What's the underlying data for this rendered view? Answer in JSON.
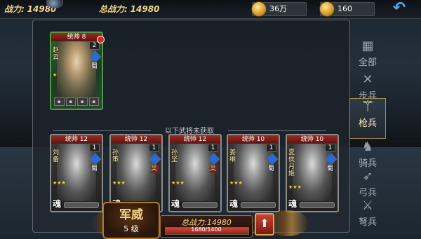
{
  "topbar": {
    "power_label": "战力:",
    "power_value": "14980",
    "total_label": "总战力:",
    "total_value": "14980",
    "silver": "36万",
    "gold": "160"
  },
  "sidebar": {
    "items": [
      {
        "label": "全部",
        "icon": "grid-icon"
      },
      {
        "label": "步兵",
        "icon": "crossed-swords-icon"
      },
      {
        "label": "枪兵",
        "icon": "spear-icon"
      },
      {
        "label": "骑兵",
        "icon": "horse-icon"
      },
      {
        "label": "弓兵",
        "icon": "bow-icon"
      },
      {
        "label": "弩兵",
        "icon": "crossbow-icon"
      }
    ],
    "active_index": 2
  },
  "owned_hero": {
    "banner": "统帅 8",
    "name": "赵云",
    "level": "2",
    "faction": "蜀"
  },
  "divider_text": "以下武将未获取",
  "locked_heroes": [
    {
      "banner": "统帅 12",
      "name": "刘备",
      "level": "1",
      "faction": "蜀",
      "soul": "魂"
    },
    {
      "banner": "统帅 12",
      "name": "孙策",
      "level": "1",
      "faction": "吴",
      "soul": "魂"
    },
    {
      "banner": "统帅 12",
      "name": "孙坚",
      "level": "1",
      "faction": "吴",
      "soul": "魂"
    },
    {
      "banner": "统帅 10",
      "name": "姜维",
      "level": "1",
      "faction": "蜀",
      "soul": "魂"
    },
    {
      "banner": "统帅 10",
      "name": "夏侯月姬",
      "level": "1",
      "faction": "蜀",
      "soul": "魂"
    }
  ],
  "bottom": {
    "rank_title": "军威",
    "rank_level": "5 级",
    "power_label": "总战力:",
    "power_value": "14980",
    "progress_text": "1680/1400",
    "progress_fraction": 1.0
  },
  "colors": {
    "gold_text": "#f0d589",
    "card_green": "#4f9a48",
    "card_gray": "#8b8b8b",
    "banner_red": "#9b2a22",
    "back_blue": "#5ea6e6"
  }
}
